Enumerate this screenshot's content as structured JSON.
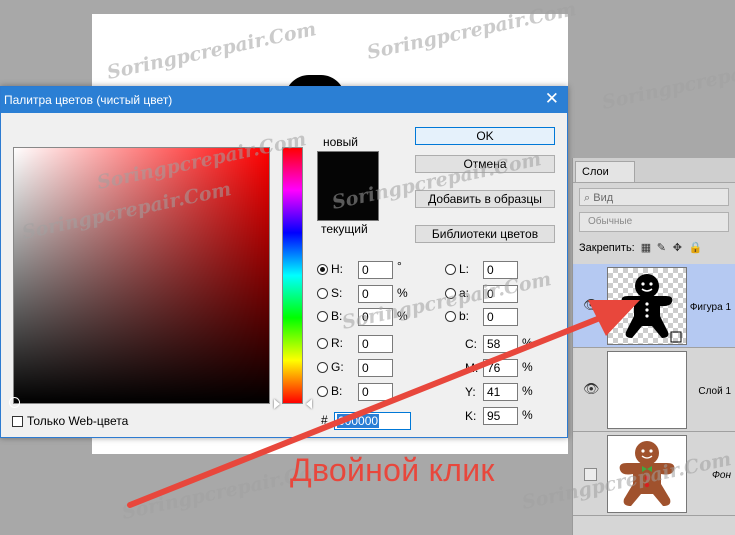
{
  "dialog": {
    "title": "Палитра цветов (чистый цвет)",
    "close_glyph": "✕",
    "new_label": "новый",
    "current_label": "текущий",
    "buttons": {
      "ok": "OK",
      "cancel": "Отмена",
      "add_to_swatches": "Добавить в образцы",
      "color_libraries": "Библиотеки цветов"
    },
    "hsb": [
      {
        "label": "H:",
        "value": "0",
        "unit": "°",
        "selected": true
      },
      {
        "label": "S:",
        "value": "0",
        "unit": "%",
        "selected": false
      },
      {
        "label": "B:",
        "value": "0",
        "unit": "%",
        "selected": false
      }
    ],
    "rgb": [
      {
        "label": "R:",
        "value": "0"
      },
      {
        "label": "G:",
        "value": "0"
      },
      {
        "label": "B:",
        "value": "0"
      }
    ],
    "lab": [
      {
        "label": "L:",
        "value": "0"
      },
      {
        "label": "a:",
        "value": "0"
      },
      {
        "label": "b:",
        "value": "0"
      }
    ],
    "cmyk": [
      {
        "label": "C:",
        "value": "58",
        "unit": "%"
      },
      {
        "label": "M:",
        "value": "76",
        "unit": "%"
      },
      {
        "label": "Y:",
        "value": "41",
        "unit": "%"
      },
      {
        "label": "K:",
        "value": "95",
        "unit": "%"
      }
    ],
    "hex_label": "#",
    "hex_value": "000000",
    "web_only_label": "Только Web-цвета",
    "new_color": "#050505"
  },
  "layers_panel": {
    "tab": "Слои",
    "search_placeholder": "Вид",
    "search_icon": "search-icon",
    "blend_mode": "Обычные",
    "lock_label": "Закрепить:",
    "layers": [
      {
        "name": "Фигура 1",
        "visible": true,
        "selected": true,
        "italic": false
      },
      {
        "name": "Слой 1",
        "visible": true,
        "selected": false,
        "italic": false
      },
      {
        "name": "Фон",
        "visible": false,
        "selected": false,
        "italic": true
      }
    ]
  },
  "annotation": {
    "text": "Двойной клик",
    "color": "#e8473c"
  },
  "watermark": "Soringpcrepair.Com"
}
